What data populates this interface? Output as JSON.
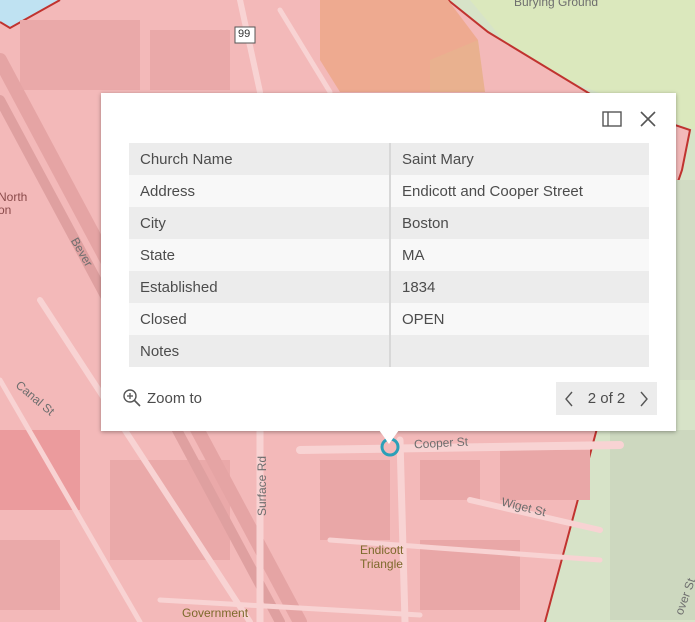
{
  "map": {
    "colors": {
      "pink_fill": "#f4b7b9",
      "red_outline": "#c0332f",
      "green_area": "#d8e8c4",
      "street": "#f7cdce",
      "highlight": "#2ba0b8"
    },
    "labels": {
      "burying_ground": "Burying Ground",
      "route_99": "99",
      "north": "North",
      "on": "on",
      "beverly": "Bever",
      "canal_st": "Canal St",
      "surface_rd": "Surface Rd",
      "cooper_st": "Cooper St",
      "wiget_st": "Wiget St",
      "endicott": "Endicott",
      "triangle": "Triangle",
      "government": "Government",
      "over_st": "over St"
    }
  },
  "popup": {
    "dock_icon": "dock-icon",
    "close_icon": "close-icon",
    "fields": [
      {
        "name": "Church Name",
        "value": "Saint Mary"
      },
      {
        "name": "Address",
        "value": "Endicott and Cooper Street"
      },
      {
        "name": "City",
        "value": "Boston"
      },
      {
        "name": "State",
        "value": "MA"
      },
      {
        "name": "Established",
        "value": "1834"
      },
      {
        "name": "Closed",
        "value": "OPEN"
      },
      {
        "name": "Notes",
        "value": ""
      }
    ],
    "zoom_label": "Zoom to",
    "pager_label": "2 of 2"
  }
}
